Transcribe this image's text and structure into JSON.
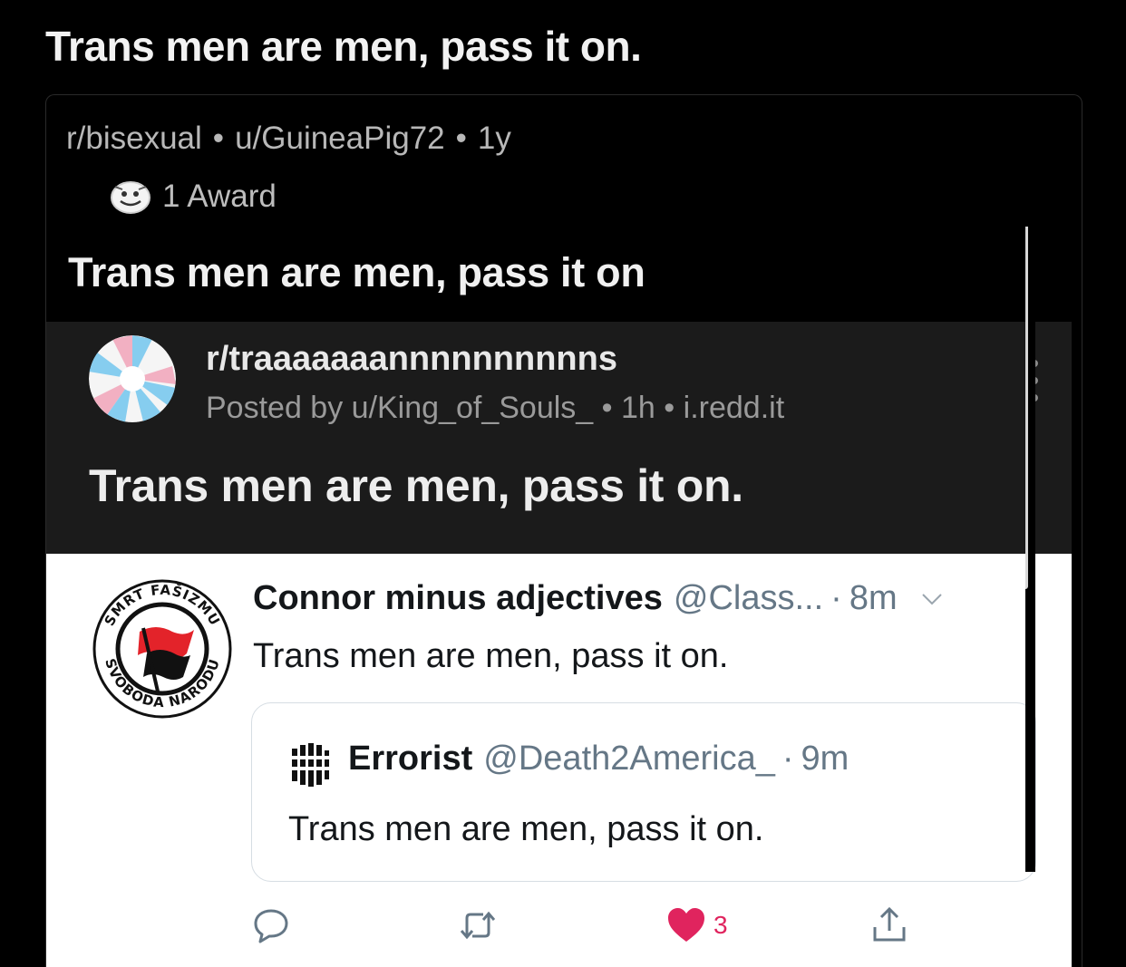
{
  "page": {
    "title": "Trans men are men, pass it on."
  },
  "crosspost": {
    "subreddit": "r/bisexual",
    "user": "u/GuineaPig72",
    "age": "1y",
    "award_label": "1 Award",
    "title": "Trans men are men, pass it on"
  },
  "reddit_screenshot": {
    "subreddit": "r/traaaaaaannnnnnnnnns",
    "posted_by": "Posted by u/King_of_Souls_",
    "age": "1h",
    "domain": "i.redd.it",
    "title": "Trans men are men, pass it on."
  },
  "tweet": {
    "avatar_ring_top": "SMRT FAŠIZMU",
    "avatar_ring_bottom": "SVOBODA NARODU",
    "name": "Connor minus adjectives",
    "handle": "@Class...",
    "time": "8m",
    "text": "Trans men are men, pass it on.",
    "quote": {
      "name": "Errorist",
      "handle": "@Death2America_",
      "time": "9m",
      "text": "Trans men are men, pass it on."
    },
    "actions": {
      "like_count": "3"
    }
  },
  "colors": {
    "background": "#000000",
    "reddit_bg": "#1b1b1b",
    "tweet_bg": "#ffffff",
    "like": "#e0245e",
    "twitter_gray": "#657786"
  },
  "icons": [
    "award-icon",
    "more-options-icon",
    "chevron-down-icon",
    "reply-icon",
    "retweet-icon",
    "heart-icon",
    "share-icon"
  ]
}
